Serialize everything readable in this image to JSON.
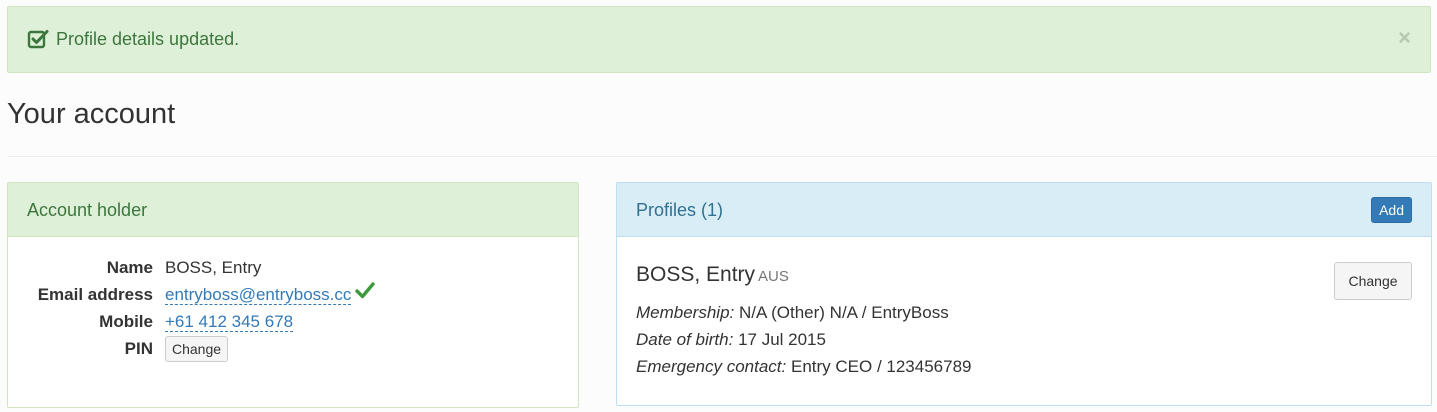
{
  "alert": {
    "message": "Profile details updated.",
    "close": "×",
    "icon": "check-square-icon"
  },
  "page": {
    "title": "Your account"
  },
  "account_holder": {
    "heading": "Account holder",
    "fields": [
      {
        "label": "Name",
        "value": "BOSS, Entry"
      },
      {
        "label": "Email address",
        "value": "entryboss@entryboss.cc",
        "verified_icon": "checkmark-icon"
      },
      {
        "label": "Mobile",
        "value": "+61 412 345 678"
      },
      {
        "label": "PIN",
        "button": "Change"
      }
    ]
  },
  "profiles": {
    "heading": "Profiles (1)",
    "add_button": "Add",
    "items": [
      {
        "name": "BOSS, Entry",
        "country": "AUS",
        "change_button": "Change",
        "membership_label": "Membership:",
        "membership_value": "N/A (Other) N/A / EntryBoss",
        "dob_label": "Date of birth:",
        "dob_value": "17 Jul 2015",
        "emergency_label": "Emergency contact:",
        "emergency_value": "Entry CEO / 123456789"
      }
    ]
  },
  "colors": {
    "success_bg": "#dff0d8",
    "success_text": "#3c763d",
    "info_bg": "#d9edf7",
    "info_text": "#31708f",
    "primary": "#337ab7",
    "verified": "#3c9a3c"
  }
}
